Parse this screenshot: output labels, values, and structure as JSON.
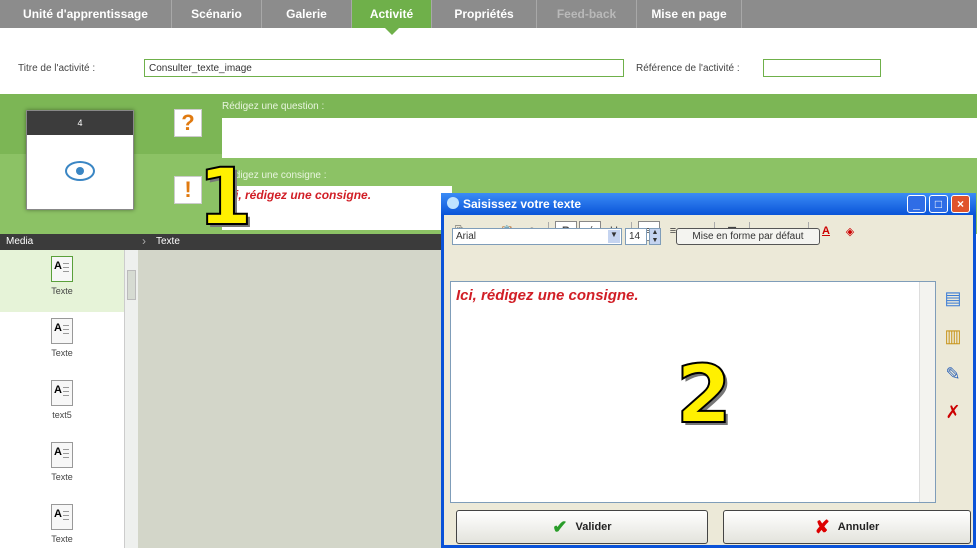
{
  "tabs": [
    {
      "label": "Unité d'apprentissage"
    },
    {
      "label": "Scénario"
    },
    {
      "label": "Galerie"
    },
    {
      "label": "Activité"
    },
    {
      "label": "Propriétés"
    },
    {
      "label": "Feed-back"
    },
    {
      "label": "Mise en page"
    }
  ],
  "activity": {
    "title_label": "Titre de l'activité :",
    "title_value": "Consulter_texte_image",
    "ref_label": "Référence de l'activité :",
    "ref_value": ""
  },
  "question": {
    "question_label": "Rédigez une question :",
    "question_icon": "?",
    "consigne_label": "Rédigez une consigne :",
    "consigne_icon": "!",
    "consigne_text": "Ici, rédigez une consigne."
  },
  "thumbnail": {
    "number": "4"
  },
  "media": {
    "header": "Media",
    "breadcrumb": "Texte",
    "items": [
      {
        "label": "Texte"
      },
      {
        "label": "Texte"
      },
      {
        "label": "text5"
      },
      {
        "label": "Texte"
      },
      {
        "label": "Texte"
      }
    ]
  },
  "dialog": {
    "title": "Saisissez votre texte",
    "font": "Arial",
    "size": "14",
    "default_format": "Mise en forme par défaut",
    "content": "Ici, rédigez une consigne.",
    "ok": "Valider",
    "cancel": "Annuler"
  },
  "callouts": {
    "one": "1",
    "two": "2"
  },
  "colors": {
    "accent": "#6fb04a",
    "dialog_title": "#0a54d8",
    "consigne_text": "#d11e26"
  }
}
